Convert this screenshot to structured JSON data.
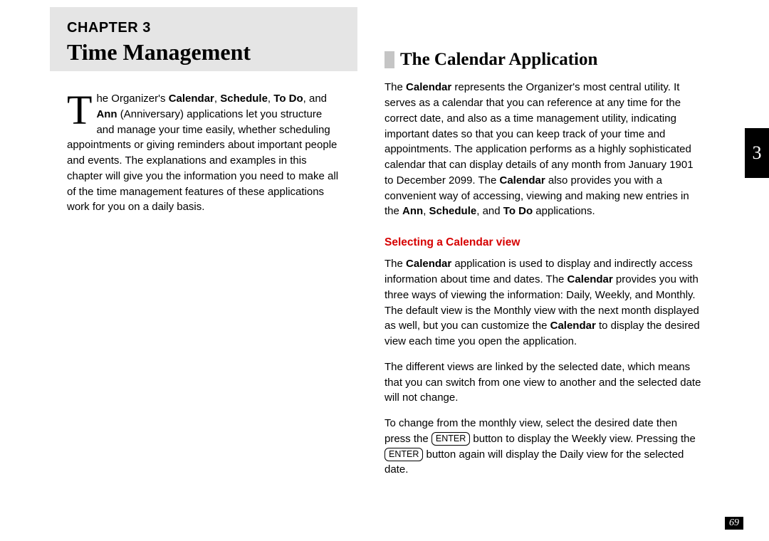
{
  "header": {
    "chapter_label": "CHAPTER 3",
    "chapter_title": "Time Management"
  },
  "left": {
    "dropcap": "T",
    "p1_a": "he Organizer's ",
    "p1_b1": "Calendar",
    "p1_c": ", ",
    "p1_b2": "Schedule",
    "p1_d": ", ",
    "p1_b3": "To Do",
    "p1_e": ", and ",
    "p1_b4": "Ann",
    "p1_f": " (Anniversary) applications let you structure and manage your time easily, whether scheduling appointments or giving reminders about important people and events. The explanations and examples in this chapter will give you the information you need to make all of the time management features of these applications work for you on a daily basis."
  },
  "right": {
    "section_title": "The Calendar Application",
    "p1_a": "The ",
    "p1_b1": "Calendar",
    "p1_c": " represents the Organizer's most central utility. It serves as a calendar that you can reference at any time for the correct date, and also as a time management utility, indicating important dates so that you can keep track of your time and appointments. The application performs as a highly sophisticated calendar that can display details of any month from January 1901 to December 2099. The ",
    "p1_b2": "Calendar",
    "p1_d": " also provides you with a convenient way of accessing, viewing and making new entries in the ",
    "p1_b3": "Ann",
    "p1_e": ", ",
    "p1_b4": "Schedule",
    "p1_f": ", and ",
    "p1_b5": "To Do",
    "p1_g": " applications.",
    "subhead": "Selecting a Calendar view",
    "p2_a": "The ",
    "p2_b1": "Calendar",
    "p2_c": " application is used to display and indirectly access information about time and dates. The ",
    "p2_b2": "Calendar",
    "p2_d": " provides you with three ways of viewing the information: Daily, Weekly, and Monthly.  The default view is the Monthly view with the next month displayed as well, but you can customize the ",
    "p2_b3": "Calendar",
    "p2_e": " to display the desired view each time you open the application.",
    "p3": "The different views are linked by the selected date, which means that you can switch from one view to another and the selected date will not change.",
    "p4_a": "To change from the monthly view, select the desired date then press the ",
    "p4_key1": "ENTER",
    "p4_b": " button to display the Weekly view. Pressing the ",
    "p4_key2": "ENTER",
    "p4_c": " button again will display the Daily view for the selected date."
  },
  "tab": {
    "number": "3"
  },
  "page_number": "69"
}
